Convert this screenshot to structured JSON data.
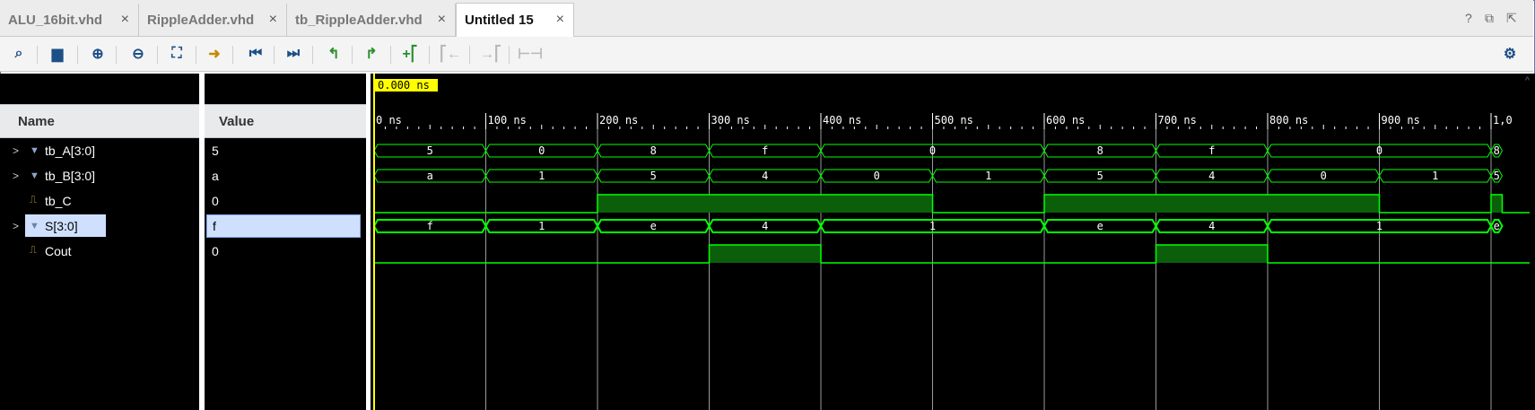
{
  "tabs": [
    {
      "label": "ALU_16bit.vhd",
      "active": false
    },
    {
      "label": "RippleAdder.vhd",
      "active": false
    },
    {
      "label": "tb_RippleAdder.vhd",
      "active": false
    },
    {
      "label": "Untitled 15",
      "active": true
    }
  ],
  "window_controls": {
    "help": "?",
    "restore": "⧉",
    "float": "⇱"
  },
  "columns": {
    "name": "Name",
    "value": "Value"
  },
  "signals": [
    {
      "name": "tb_A[3:0]",
      "value": "5",
      "bus": true,
      "selected": false
    },
    {
      "name": "tb_B[3:0]",
      "value": "a",
      "bus": true,
      "selected": false
    },
    {
      "name": "tb_C",
      "value": "0",
      "bus": false,
      "selected": false
    },
    {
      "name": "S[3:0]",
      "value": "f",
      "bus": true,
      "selected": true
    },
    {
      "name": "Cout",
      "value": "0",
      "bus": false,
      "selected": false
    }
  ],
  "cursor_label": "0.000 ns",
  "ruler_labels": [
    "0 ns",
    "100 ns",
    "200 ns",
    "300 ns",
    "400 ns",
    "500 ns",
    "600 ns",
    "700 ns",
    "800 ns",
    "900 ns",
    "1,0"
  ],
  "colors": {
    "wave": "#00ff00",
    "high_fill": "#0b5f0b",
    "cursor": "#ffff00",
    "grid": "#9a9a9a"
  },
  "chart_data": {
    "type": "waveform",
    "time_unit": "ns",
    "xlim": [
      0,
      1000
    ],
    "buses": [
      {
        "name": "tb_A[3:0]",
        "segments": [
          [
            0,
            100,
            "5"
          ],
          [
            100,
            200,
            "0"
          ],
          [
            200,
            300,
            "8"
          ],
          [
            300,
            400,
            "f"
          ],
          [
            400,
            600,
            "0"
          ],
          [
            600,
            700,
            "8"
          ],
          [
            700,
            800,
            "f"
          ],
          [
            800,
            1000,
            "0"
          ],
          [
            1000,
            1010,
            "8"
          ]
        ]
      },
      {
        "name": "tb_B[3:0]",
        "segments": [
          [
            0,
            100,
            "a"
          ],
          [
            100,
            200,
            "1"
          ],
          [
            200,
            300,
            "5"
          ],
          [
            300,
            400,
            "4"
          ],
          [
            400,
            500,
            "0"
          ],
          [
            500,
            600,
            "1"
          ],
          [
            600,
            700,
            "5"
          ],
          [
            700,
            800,
            "4"
          ],
          [
            800,
            900,
            "0"
          ],
          [
            900,
            1000,
            "1"
          ],
          [
            1000,
            1010,
            "5"
          ]
        ]
      },
      {
        "name": "S[3:0]",
        "segments": [
          [
            0,
            100,
            "f"
          ],
          [
            100,
            200,
            "1"
          ],
          [
            200,
            300,
            "e"
          ],
          [
            300,
            400,
            "4"
          ],
          [
            400,
            600,
            "1"
          ],
          [
            600,
            700,
            "e"
          ],
          [
            700,
            800,
            "4"
          ],
          [
            800,
            1000,
            "1"
          ],
          [
            1000,
            1010,
            "e"
          ]
        ]
      }
    ],
    "bits": [
      {
        "name": "tb_C",
        "high_intervals": [
          [
            200,
            500
          ],
          [
            600,
            900
          ],
          [
            1000,
            1010
          ]
        ]
      },
      {
        "name": "Cout",
        "high_intervals": [
          [
            300,
            400
          ],
          [
            700,
            800
          ]
        ]
      }
    ]
  }
}
